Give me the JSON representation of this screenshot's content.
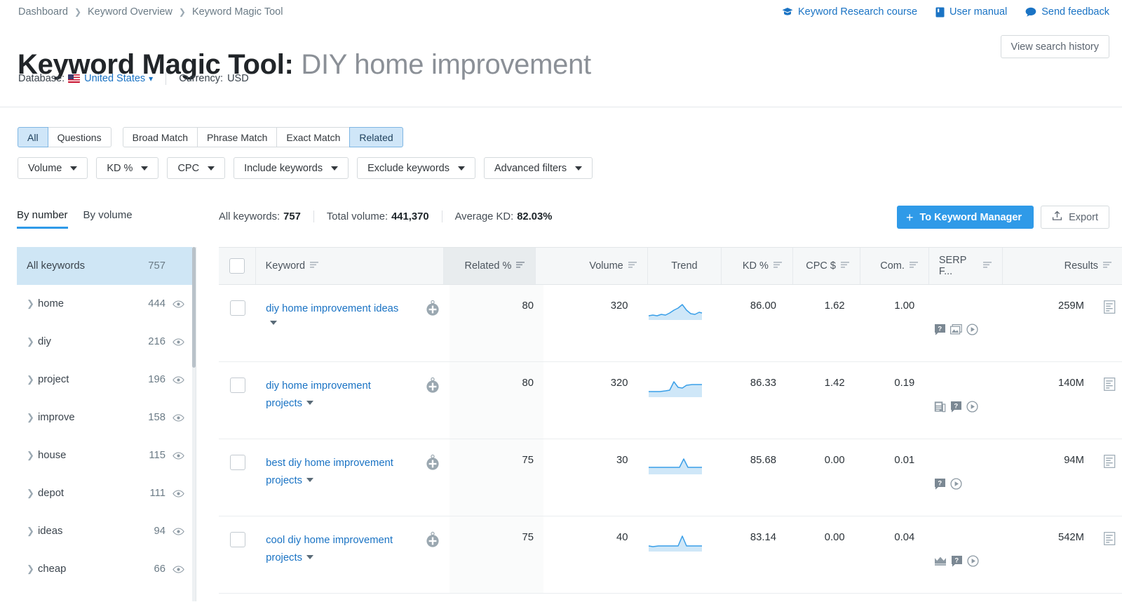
{
  "breadcrumb": [
    "Dashboard",
    "Keyword Overview",
    "Keyword Magic Tool"
  ],
  "toplinks": [
    {
      "label": "Keyword Research course",
      "icon": "graduation-cap-icon"
    },
    {
      "label": "User manual",
      "icon": "book-icon"
    },
    {
      "label": "Send feedback",
      "icon": "chat-bubble-icon"
    }
  ],
  "title": {
    "prefix": "Keyword Magic Tool:",
    "query": "DIY home improvement"
  },
  "search_history_label": "View search history",
  "database": {
    "label": "Database:",
    "value": "United States",
    "flag": "us-flag-icon",
    "currency_label": "Currency:",
    "currency_value": "USD"
  },
  "match_filters": [
    {
      "label": "All",
      "active": true
    },
    {
      "label": "Questions",
      "active": false
    }
  ],
  "match_types": [
    {
      "label": "Broad Match",
      "active": false
    },
    {
      "label": "Phrase Match",
      "active": false
    },
    {
      "label": "Exact Match",
      "active": false
    },
    {
      "label": "Related",
      "active": true
    }
  ],
  "dropdowns": [
    "Volume",
    "KD %",
    "CPC",
    "Include keywords",
    "Exclude keywords",
    "Advanced filters"
  ],
  "view_tabs": [
    {
      "label": "By number",
      "selected": true
    },
    {
      "label": "By volume",
      "selected": false
    }
  ],
  "stats": [
    {
      "label": "All keywords:",
      "value": "757"
    },
    {
      "label": "Total volume:",
      "value": "441,370"
    },
    {
      "label": "Average KD:",
      "value": "82.03%"
    }
  ],
  "actions": {
    "primary_label": "To Keyword Manager",
    "primary_plus": "+",
    "export_label": "Export",
    "export_icon": "upload-icon"
  },
  "sidebar": {
    "all_label": "All keywords",
    "all_count": "757",
    "items": [
      {
        "label": "home",
        "count": "444"
      },
      {
        "label": "diy",
        "count": "216"
      },
      {
        "label": "project",
        "count": "196"
      },
      {
        "label": "improve",
        "count": "158"
      },
      {
        "label": "house",
        "count": "115"
      },
      {
        "label": "depot",
        "count": "111"
      },
      {
        "label": "ideas",
        "count": "94"
      },
      {
        "label": "cheap",
        "count": "66"
      }
    ]
  },
  "table": {
    "columns": [
      {
        "key": "checkbox",
        "label": ""
      },
      {
        "key": "keyword",
        "label": "Keyword",
        "sortable": true
      },
      {
        "key": "add",
        "label": ""
      },
      {
        "key": "related",
        "label": "Related %",
        "sortable": true,
        "highlighted": true
      },
      {
        "key": "volume",
        "label": "Volume",
        "sortable": true
      },
      {
        "key": "trend",
        "label": "Trend",
        "sortable": false
      },
      {
        "key": "kd",
        "label": "KD %",
        "sortable": true
      },
      {
        "key": "cpc",
        "label": "CPC $",
        "sortable": true
      },
      {
        "key": "com",
        "label": "Com.",
        "sortable": true
      },
      {
        "key": "serp",
        "label": "SERP F...",
        "sortable": true
      },
      {
        "key": "results",
        "label": "Results",
        "sortable": true
      }
    ],
    "rows": [
      {
        "keyword": "diy home improvement ideas",
        "related": "80",
        "volume": "320",
        "kd": "86.00",
        "cpc": "1.62",
        "com": "1.00",
        "results": "259M",
        "serp_features": [
          "faq-icon",
          "image-icon",
          "video-icon"
        ],
        "trend": [
          22,
          21,
          22,
          20,
          21,
          18,
          14,
          11,
          6,
          14,
          19,
          20,
          17,
          18
        ],
        "add_icon": "add-to-list-icon",
        "doc_icon": "serp-preview-icon"
      },
      {
        "keyword": "diy home improvement projects",
        "related": "80",
        "volume": "320",
        "kd": "86.33",
        "cpc": "1.42",
        "com": "0.19",
        "results": "140M",
        "serp_features": [
          "news-icon",
          "faq-icon",
          "video-icon"
        ],
        "trend": [
          24,
          24,
          23,
          22,
          22,
          20,
          7,
          16,
          18,
          14,
          13,
          13,
          11,
          11
        ],
        "add_icon": "add-to-list-icon",
        "doc_icon": "serp-preview-icon"
      },
      {
        "keyword": "best diy home improvement projects",
        "related": "75",
        "volume": "30",
        "kd": "85.68",
        "cpc": "0.00",
        "com": "0.01",
        "results": "94M",
        "serp_features": [
          "faq-icon",
          "video-icon"
        ],
        "trend": [
          23,
          23,
          23,
          23,
          23,
          23,
          23,
          23,
          22,
          8,
          18,
          23,
          23,
          23
        ],
        "add_icon": "add-to-list-icon",
        "doc_icon": "serp-preview-icon"
      },
      {
        "keyword": "cool diy home improvement projects",
        "related": "75",
        "volume": "40",
        "kd": "83.14",
        "cpc": "0.00",
        "com": "0.04",
        "results": "542M",
        "serp_features": [
          "crown-icon",
          "faq-icon",
          "video-icon"
        ],
        "trend": [
          24,
          23,
          22,
          22,
          22,
          22,
          22,
          22,
          22,
          7,
          22,
          23,
          23,
          23
        ],
        "add_icon": "add-to-list-icon",
        "doc_icon": "serp-preview-icon"
      }
    ]
  },
  "colors": {
    "accent": "#2f9ae8",
    "link": "#1a73c4",
    "active_chip_bg": "#cfe6f8",
    "sidebar_selected_bg": "#cfe6f5",
    "trend_line": "#3a9fe8",
    "trend_fill": "#cfe7f8"
  }
}
